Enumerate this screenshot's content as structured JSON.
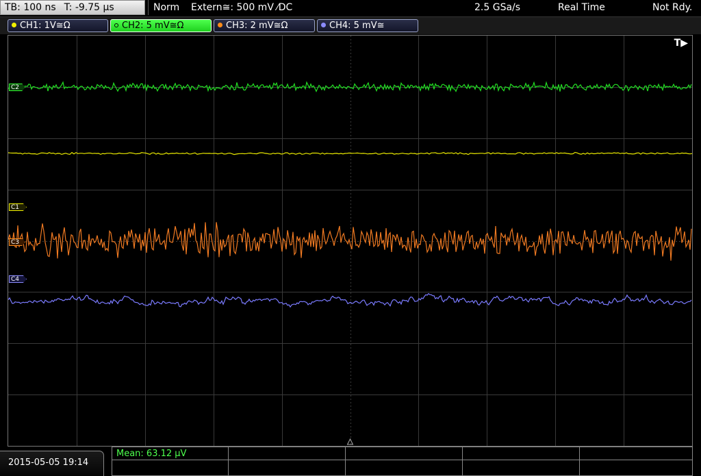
{
  "topbar": {
    "timebase": "TB: 100 ns",
    "trigger_time": "T: -9.75 µs",
    "trigger_mode": "Norm",
    "trigger_source": "Extern≅: 500 mV ⁄DC",
    "sample_rate": "2.5 GSa/s",
    "acq_mode": "Real Time",
    "status": "Not Rdy."
  },
  "channels": [
    {
      "label": "CH1: 1V≅Ω",
      "color": "#f0f000",
      "active": false
    },
    {
      "label": "CH2: 5 mV≅Ω",
      "color": "#33ff33",
      "active": true
    },
    {
      "label": "CH3: 2 mV≅Ω",
      "color": "#ff8c1a",
      "active": false
    },
    {
      "label": "CH4: 5 mV≅",
      "color": "#8c8cff",
      "active": false
    }
  ],
  "trigger_marker": "T▶",
  "markers": {
    "c1": "C1",
    "c2": "C2",
    "c3": "C3",
    "c4": "C4"
  },
  "waveforms": {
    "ch1_color": "#e8e800",
    "ch2_color": "#22e022",
    "ch3_color": "#f07a22",
    "ch4_color": "#7b7bff"
  },
  "footer": {
    "datetime": "2015-05-05 19:14",
    "measurement": "Mean: 63.12 µV"
  }
}
